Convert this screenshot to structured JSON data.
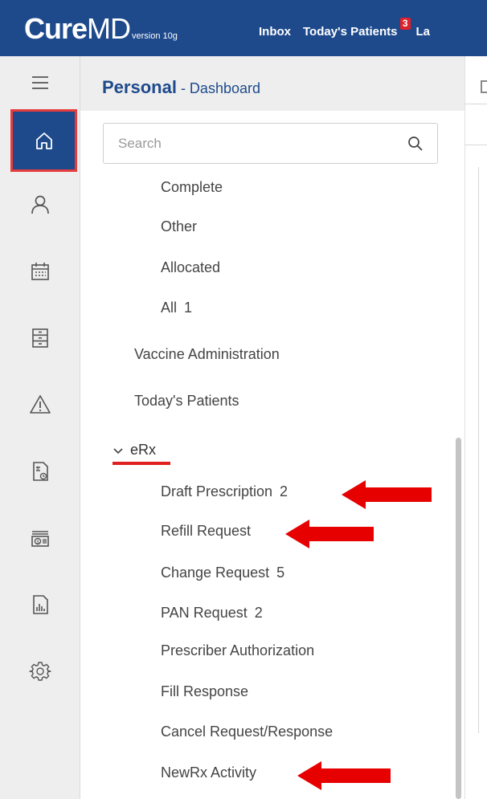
{
  "app": {
    "logo_main": "Cure",
    "logo_md": "MD",
    "logo_version": "version 10g"
  },
  "topnav": {
    "items": [
      {
        "label": "Inbox"
      },
      {
        "label": "Today's Patients",
        "badge": "3"
      },
      {
        "label": "La"
      }
    ]
  },
  "rail": {
    "items": [
      {
        "icon": "menu-icon"
      },
      {
        "icon": "home-icon",
        "active": true
      },
      {
        "icon": "user-icon"
      },
      {
        "icon": "calendar-icon"
      },
      {
        "icon": "cabinet-icon"
      },
      {
        "icon": "warning-icon"
      },
      {
        "icon": "billing-document-icon"
      },
      {
        "icon": "cash-icon"
      },
      {
        "icon": "report-icon"
      },
      {
        "icon": "settings-icon"
      }
    ]
  },
  "panel": {
    "title": "Personal",
    "subtitle": " - Dashboard"
  },
  "search": {
    "placeholder": "Search"
  },
  "tree": {
    "items": [
      {
        "label": "Complete",
        "count": ""
      },
      {
        "label": "Other",
        "count": ""
      },
      {
        "label": "Allocated",
        "count": ""
      },
      {
        "label": "All",
        "count": "1"
      },
      {
        "label": "Vaccine Administration",
        "count": ""
      },
      {
        "label": "Today's Patients",
        "count": ""
      },
      {
        "label": "eRx",
        "count": ""
      },
      {
        "label": "Draft Prescription",
        "count": "2"
      },
      {
        "label": "Refill Request",
        "count": ""
      },
      {
        "label": "Change Request",
        "count": "5"
      },
      {
        "label": "PAN Request",
        "count": "2"
      },
      {
        "label": "Prescriber Authorization",
        "count": ""
      },
      {
        "label": "Fill Response",
        "count": ""
      },
      {
        "label": "Cancel Request/Response",
        "count": ""
      },
      {
        "label": "NewRx Activity",
        "count": ""
      }
    ]
  },
  "colors": {
    "brand": "#1e4a8c",
    "annotation": "#e02020",
    "badge": "#e0202a"
  }
}
